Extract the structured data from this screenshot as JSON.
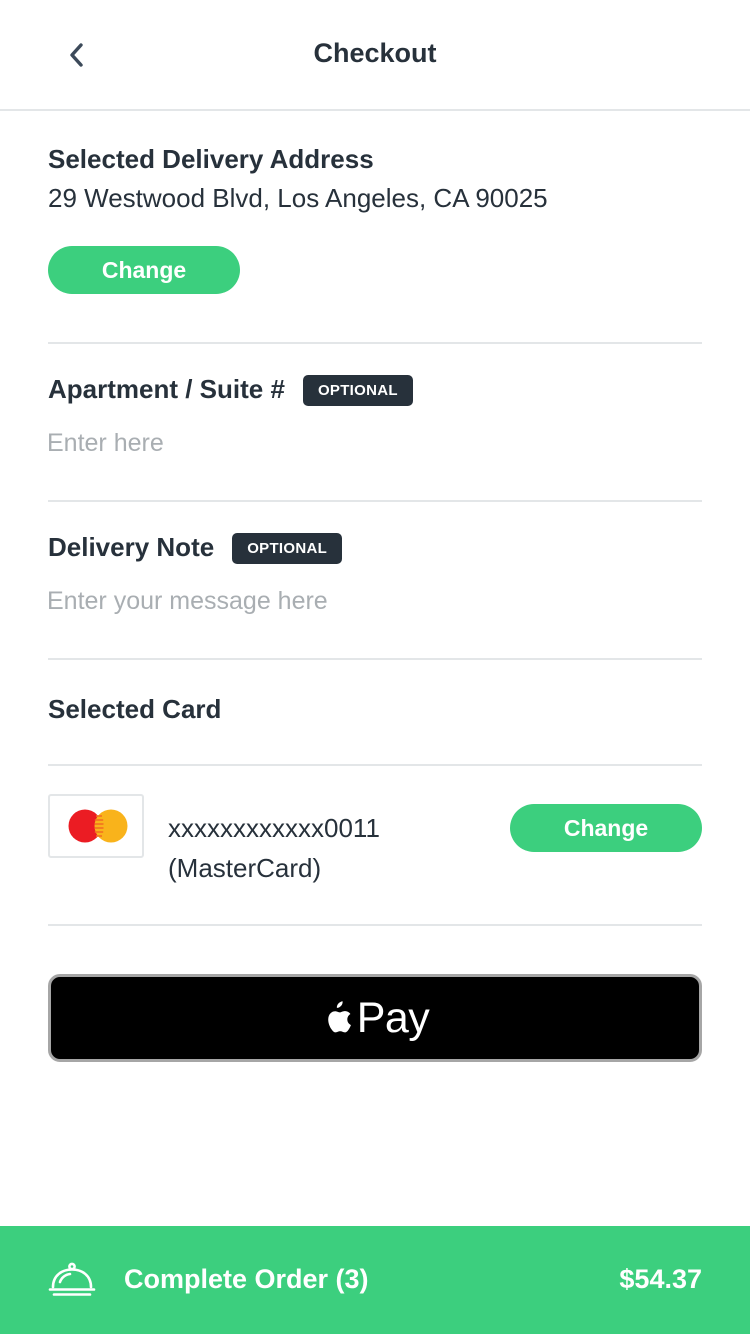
{
  "header": {
    "title": "Checkout",
    "back_icon": "chevron-left-icon"
  },
  "address": {
    "label": "Selected Delivery Address",
    "value": "29 Westwood Blvd, Los Angeles, CA 90025",
    "change_label": "Change"
  },
  "apartment": {
    "label": "Apartment / Suite #",
    "badge": "OPTIONAL",
    "value": "",
    "placeholder": "Enter here"
  },
  "note": {
    "label": "Delivery Note",
    "badge": "OPTIONAL",
    "value": "",
    "placeholder": "Enter your message here"
  },
  "card": {
    "label": "Selected Card",
    "number": "xxxxxxxxxxxx0011",
    "brand": "(MasterCard)",
    "change_label": "Change",
    "logo_icon": "mastercard-icon"
  },
  "apple_pay": {
    "label": "Pay",
    "icon": "apple-icon"
  },
  "footer": {
    "label": "Complete Order (3)",
    "price": "$54.37",
    "icon": "food-cloche-icon"
  },
  "colors": {
    "accent": "#3ccf7e",
    "text": "#27313b",
    "placeholder": "#a9aeb2",
    "divider": "#e3e6e8",
    "badge_bg": "#27313b"
  }
}
